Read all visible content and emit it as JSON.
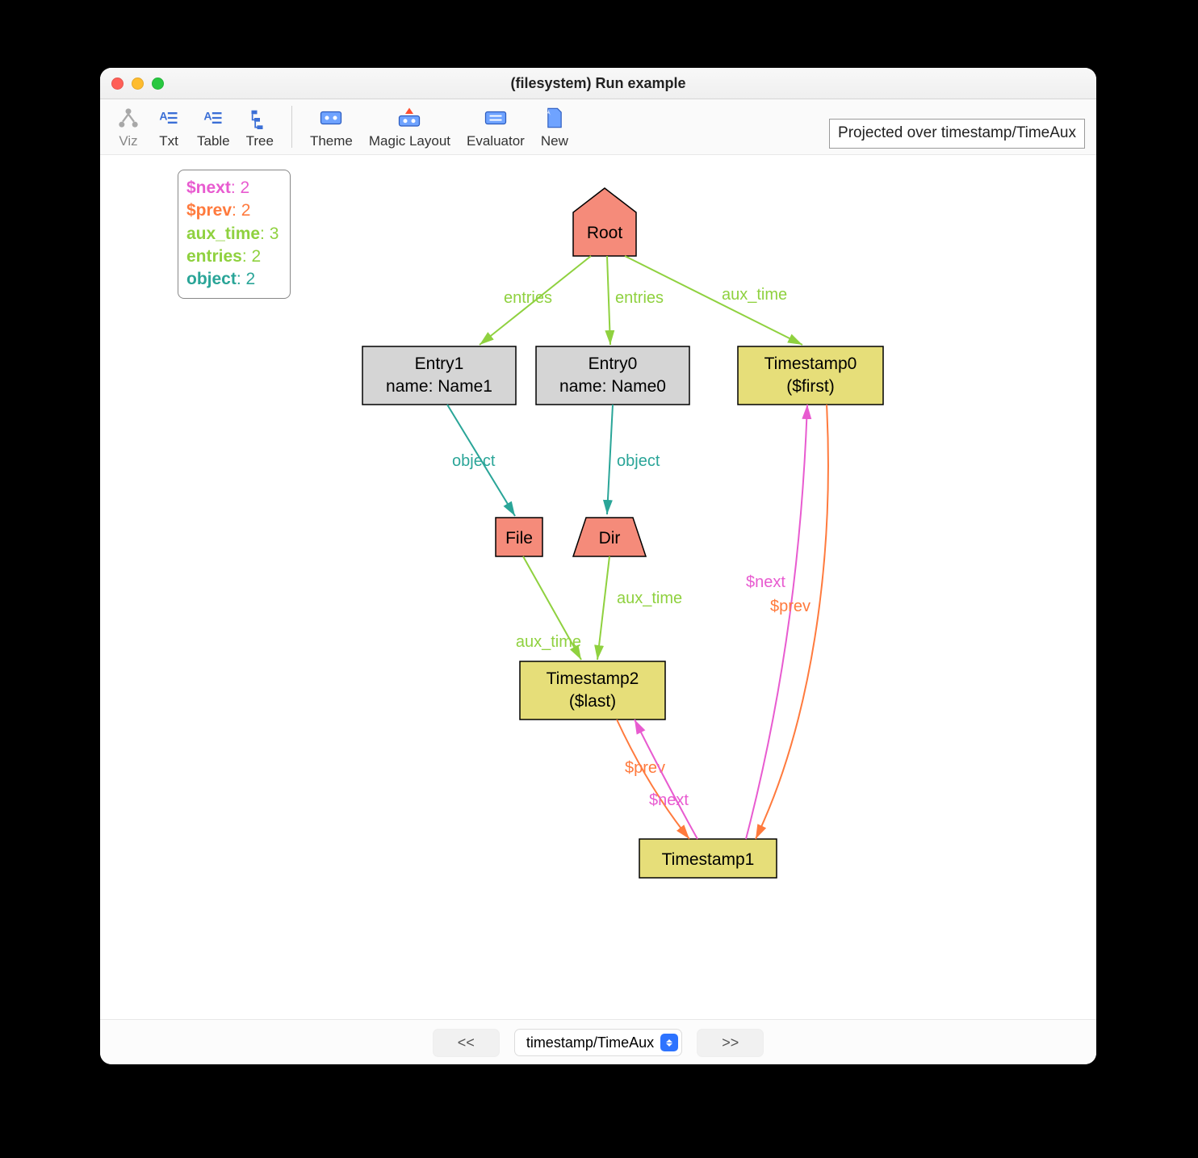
{
  "window": {
    "title": "(filesystem) Run example"
  },
  "toolbar": {
    "viz": "Viz",
    "txt": "Txt",
    "table": "Table",
    "tree": "Tree",
    "theme": "Theme",
    "magic_layout": "Magic Layout",
    "evaluator": "Evaluator",
    "new": "New",
    "projection": "Projected over timestamp/TimeAux"
  },
  "legend": {
    "rows": [
      {
        "key": "$next",
        "val": "2",
        "cls": "c-next"
      },
      {
        "key": "$prev",
        "val": "2",
        "cls": "c-prev"
      },
      {
        "key": "aux_time",
        "val": "3",
        "cls": "c-aux"
      },
      {
        "key": "entries",
        "val": "2",
        "cls": "c-ent"
      },
      {
        "key": "object",
        "val": "2",
        "cls": "c-obj"
      }
    ]
  },
  "nodes": {
    "root": {
      "line1": "Root"
    },
    "entry1": {
      "line1": "Entry1",
      "line2": "name: Name1"
    },
    "entry0": {
      "line1": "Entry0",
      "line2": "name: Name0"
    },
    "ts0": {
      "line1": "Timestamp0",
      "line2": "($first)"
    },
    "file": {
      "line1": "File"
    },
    "dir": {
      "line1": "Dir"
    },
    "ts2": {
      "line1": "Timestamp2",
      "line2": "($last)"
    },
    "ts1": {
      "line1": "Timestamp1"
    }
  },
  "edges": {
    "entries1": "entries",
    "entries2": "entries",
    "auxtime_root": "aux_time",
    "object1": "object",
    "object2": "object",
    "auxtime_file": "aux_time",
    "auxtime_dir": "aux_time",
    "next_ts1_ts0": "$next",
    "prev_ts0_ts1": "$prev",
    "next_ts2_ts1": "$next",
    "prev_ts2": "$prev"
  },
  "footer": {
    "prev": "<<",
    "next": ">>",
    "select": "timestamp/TimeAux"
  }
}
